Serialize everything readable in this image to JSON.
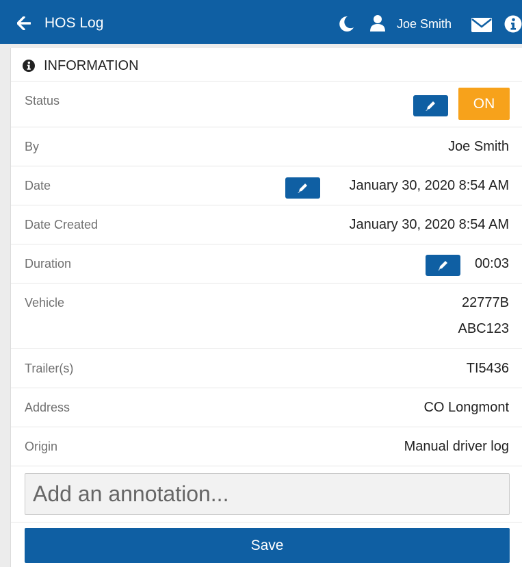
{
  "header": {
    "title": "HOS Log",
    "username": "Joe Smith",
    "icons": [
      "back-arrow-icon",
      "moon-icon",
      "user-icon",
      "mail-icon",
      "info-icon"
    ]
  },
  "panel": {
    "title": "INFORMATION",
    "icon": "info-circle-icon"
  },
  "rows": {
    "status": {
      "label": "Status",
      "value": "ON",
      "edit_icon": "pencil-icon"
    },
    "by": {
      "label": "By",
      "value": "Joe Smith"
    },
    "date": {
      "label": "Date",
      "value": "January 30, 2020 8:54 AM",
      "edit_icon": "pencil-icon"
    },
    "date_created": {
      "label": "Date Created",
      "value": "January 30, 2020 8:54 AM"
    },
    "duration": {
      "label": "Duration",
      "value": "00:03",
      "edit_icon": "pencil-icon"
    },
    "vehicle": {
      "label": "Vehicle",
      "value_line1": "22777B",
      "value_line2": "ABC123"
    },
    "trailers": {
      "label": "Trailer(s)",
      "value": "TI5436"
    },
    "address": {
      "label": "Address",
      "value": "CO Longmont"
    },
    "origin": {
      "label": "Origin",
      "value": "Manual driver log"
    }
  },
  "annotation": {
    "placeholder": "Add an annotation...",
    "value": ""
  },
  "save_label": "Save",
  "colors": {
    "primary": "#0f5fa3",
    "status_on": "#f7a21b"
  }
}
